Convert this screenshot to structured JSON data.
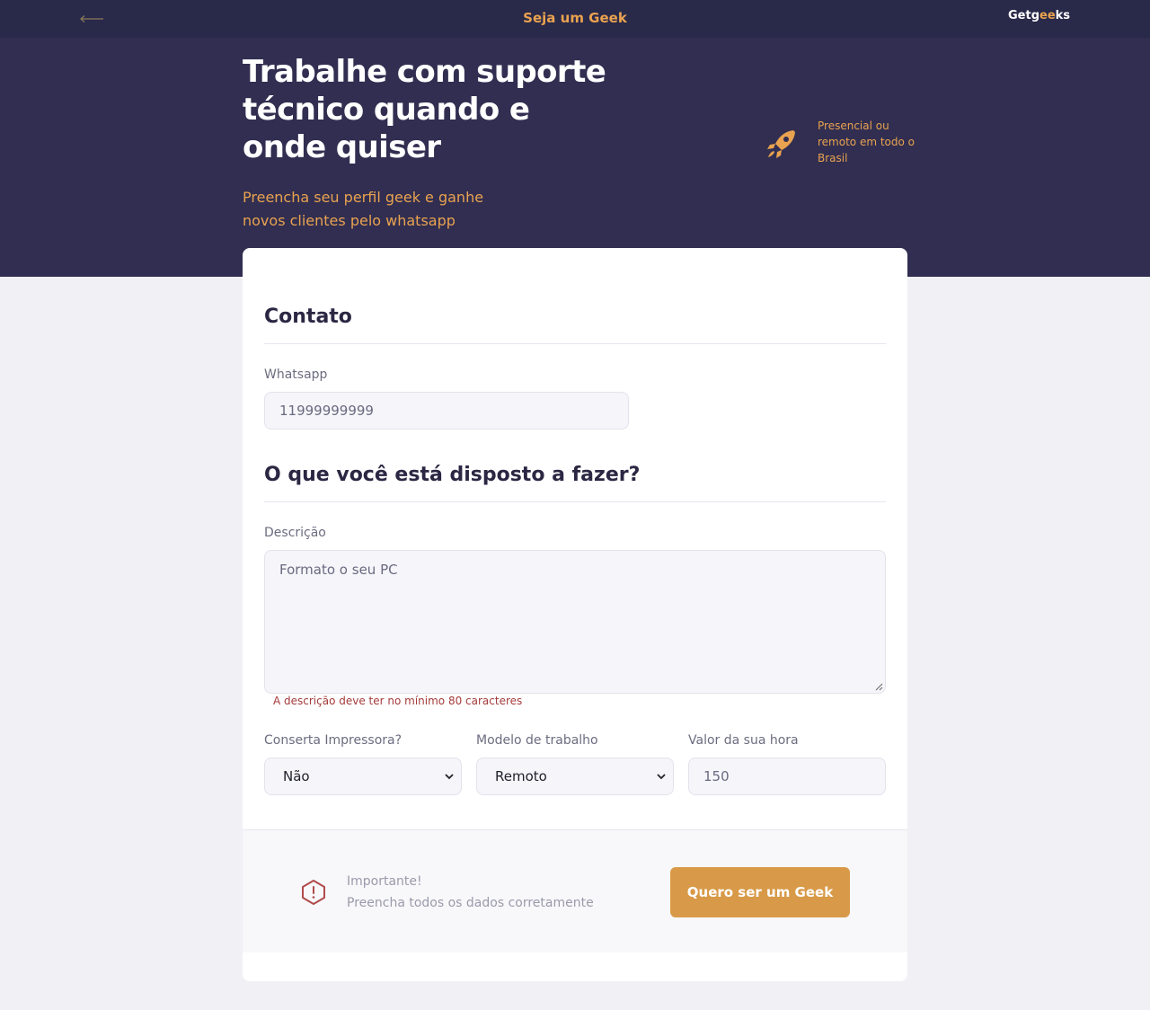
{
  "header": {
    "title": "Seja um Geek",
    "logo_prefix": "Getg",
    "logo_middle": "ee",
    "logo_suffix": "ks"
  },
  "hero": {
    "title": "Trabalhe com suporte técnico quando e onde quiser",
    "subtitle": "Preencha seu perfil geek e ganhe novos clientes pelo whatsapp",
    "note": "Presencial ou remoto em todo o Brasil"
  },
  "form": {
    "contact_section": "Contato",
    "whatsapp_label": "Whatsapp",
    "whatsapp_value": "11999999999",
    "services_section": "O que você está disposto a fazer?",
    "description_label": "Descrição",
    "description_value": "Formato o seu PC",
    "description_error": "A descrição deve ter no mínimo 80 caracteres",
    "printer_label": "Conserta Impressora?",
    "printer_value": "Não",
    "work_model_label": "Modelo de trabalho",
    "work_model_value": "Remoto",
    "hourly_rate_label": "Valor da sua hora",
    "hourly_rate_value": "150"
  },
  "footer": {
    "warning_title": "Importante!",
    "warning_text": "Preencha todos os dados corretamente",
    "submit_label": "Quero ser um Geek"
  },
  "colors": {
    "header_bg": "#29294a",
    "hero_bg": "#312e51",
    "accent": "#e9a24f",
    "button": "#d89a48",
    "error": "#a53a3a",
    "page_bg": "#f0f0f5"
  },
  "icons": {
    "back": "arrow-left-icon",
    "hero": "rocket-icon",
    "warning": "alert-hexagon-icon",
    "select": "chevron-down-icon"
  }
}
